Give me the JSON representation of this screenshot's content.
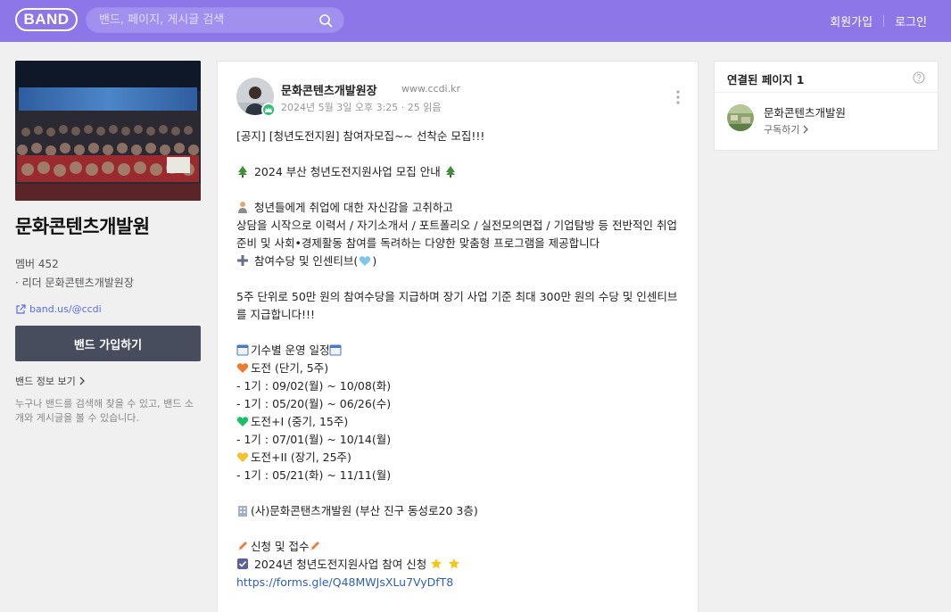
{
  "header": {
    "logo": "BAND",
    "search_placeholder": "밴드, 페이지, 게시글 검색",
    "signup": "회원가입",
    "login": "로그인"
  },
  "band": {
    "name": "문화콘텐츠개발원",
    "members": "멤버 452",
    "leader": "· 리더 문화콘텐츠개발원장",
    "url": "band.us/@ccdi",
    "join_button": "밴드 가입하기",
    "info_link": "밴드 정보 보기",
    "description": "누구나 밴드를 검색해 찾을 수 있고, 밴드 소개와 게시글을 볼 수 있습니다.",
    "cover_banner": "2022년 신중년 전문준비자 사회공헌활동 성과보고회"
  },
  "post": {
    "author": "문화콘텐츠개발원장",
    "author_site": "www.ccdi.kr",
    "meta": "2024년 5월 3일 오후 3:25 · 25 읽음",
    "lines": [
      "[공지] [청년도전지원] 참여자모집~~ 선착순 모집!!!",
      "",
      "2024 부산 청년도전지원사업 모집 안내",
      "",
      "청년들에게 취업에 대한 자신감을 고취하고",
      "상담을 시작으로 이력서 / 자기소개서 / 포트폴리오 / 실전모의면접 / 기업탐방 등 전반적인 취업 준비 및 사회•경제활동 참여를 독려하는 다양한 맞춤형 프로그램을 제공합니다",
      "참여수당 및 인센티브(",
      "",
      "5주 단위로 50만 원의 참여수당을 지급하며 장기 사업 기준 최대 300만 원의 수당 및 인센티브를 지급합니다!!!",
      "",
      "기수별 운영 일정",
      "도전 (단기, 5주)",
      "- 1기 : 09/02(월) ~ 10/08(화)",
      "- 1기 : 05/20(월) ~ 06/26(수)",
      "도전+I (중기, 15주)",
      "- 1기 : 07/01(월) ~ 10/14(월)",
      "도전+II (장기, 25주)",
      "- 1기 : 05/21(화) ~ 11/11(월)",
      "",
      "(사)문화콘탠츠개발원 (부산 진구 동성로20 3층)",
      "",
      "신청 및 접수",
      "2024년 청년도전지원사업 참여 신청",
      "https://forms.gle/Q48MWJsXLu7VyDfT8"
    ]
  },
  "linked_pages": {
    "title": "연결된 페이지 1",
    "page_name": "문화콘텐츠개발원",
    "subscribe": "구독하기"
  },
  "colors": {
    "header_bg": "#8d76e8",
    "join_button_bg": "#484d5e",
    "link": "#2e5fb7"
  }
}
